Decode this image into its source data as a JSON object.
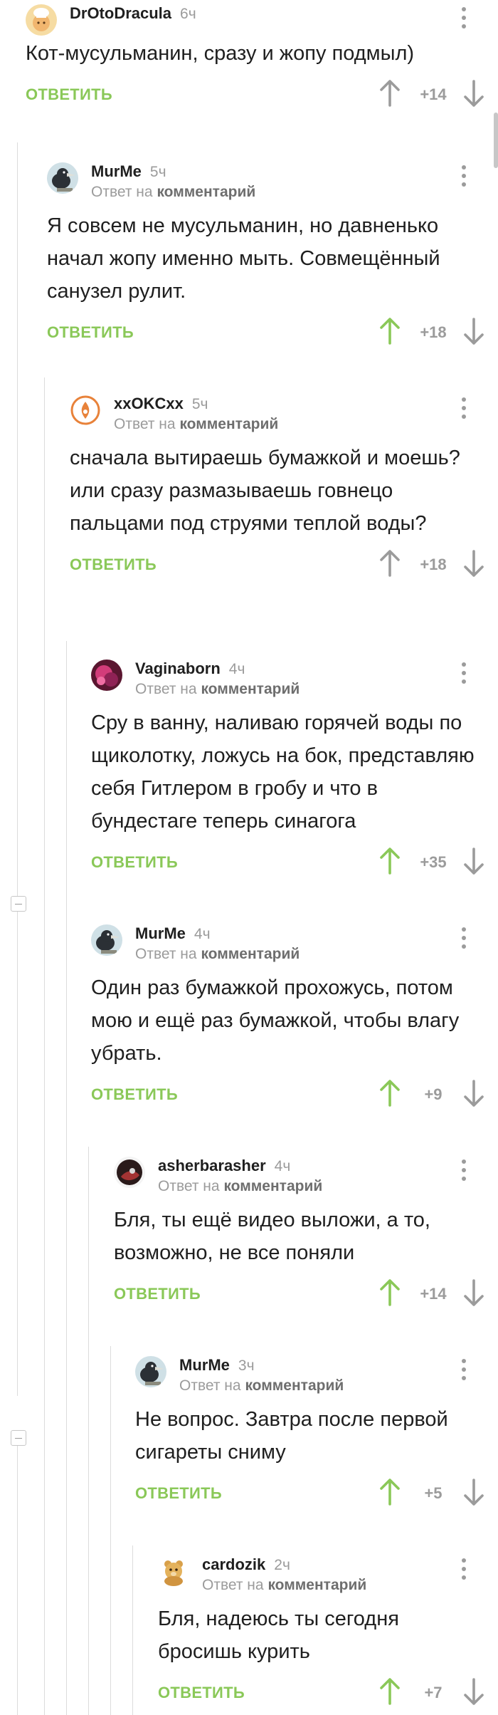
{
  "reply_word": "ОТВЕТИТЬ",
  "reply_to_prefix": "Ответ на",
  "reply_to_target": "комментарий",
  "comments": [
    {
      "user": "DrOtoDracula",
      "time": "6ч",
      "text": "Кот-мусульманин, сразу и жопу подмыл)",
      "rating": "+14",
      "upvote_color": "#9b9b9b",
      "avatar": "cook-avatar",
      "has_reply_to": false
    },
    {
      "user": "MurMe",
      "time": "5ч",
      "text": "Я совсем не мусульманин, но давненько начал жопу именно мыть. Совмещённый санузел рулит.",
      "rating": "+18",
      "upvote_color": "#8ac858",
      "avatar": "bird-avatar",
      "has_reply_to": true
    },
    {
      "user": "xxOKCxx",
      "time": "5ч",
      "text": "сначала вытираешь бумажкой и моешь? или сразу размазываешь говнецо пальцами под струями теплой воды?",
      "rating": "+18",
      "upvote_color": "#9b9b9b",
      "avatar": "badge-avatar",
      "has_reply_to": true
    },
    {
      "user": "Vaginaborn",
      "time": "4ч",
      "text": "Сру в ванну, наливаю горячей воды по щиколотку, ложусь на бок, представляю себя Гитлером в гробу и что в бундестаге теперь синагога",
      "rating": "+35",
      "upvote_color": "#8ac858",
      "avatar": "pink-avatar",
      "has_reply_to": true
    },
    {
      "user": "MurMe",
      "time": "4ч",
      "text": "Один раз бумажкой прохожусь, потом мою и ещё раз бумажкой, чтобы влагу убрать.",
      "rating": "+9",
      "upvote_color": "#8ac858",
      "avatar": "bird-avatar",
      "has_reply_to": true
    },
    {
      "user": "asherbarasher",
      "time": "4ч",
      "text": "Бля, ты ещё видео выложи, а то, возможно, не все поняли",
      "rating": "+14",
      "upvote_color": "#8ac858",
      "avatar": "dark-avatar",
      "has_reply_to": true
    },
    {
      "user": "MurMe",
      "time": "3ч",
      "text": "Не вопрос. Завтра после первой сигареты сниму",
      "rating": "+5",
      "upvote_color": "#8ac858",
      "avatar": "bird-avatar",
      "has_reply_to": true
    },
    {
      "user": "cardozik",
      "time": "2ч",
      "text": "Бля, надеюсь ты сегодня бросишь курить",
      "rating": "+7",
      "upvote_color": "#8ac858",
      "avatar": "bear-avatar",
      "has_reply_to": true
    }
  ]
}
